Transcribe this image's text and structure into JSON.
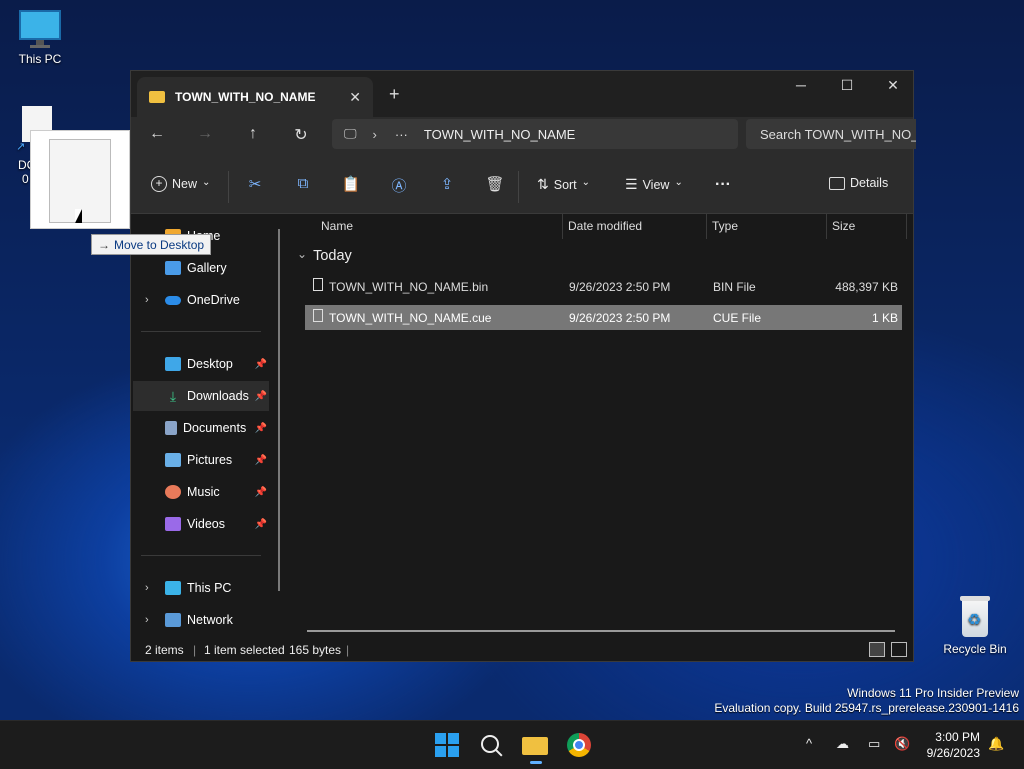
{
  "desktop": {
    "this_pc_label": "This PC",
    "dragged_icon_label_line1": "DC",
    "dragged_icon_label_line2": "0",
    "recycle_bin_label": "Recycle Bin",
    "drag_tooltip": "Move to Desktop",
    "drag_tooltip_arrow": "→",
    "watermark_line1": "Windows 11 Pro Insider Preview",
    "watermark_line2": "Evaluation copy. Build 25947.rs_prerelease.230901-1416"
  },
  "window": {
    "tab_title": "TOWN_WITH_NO_NAME",
    "tab_close": "✕",
    "new_tab": "+",
    "minimize": "─",
    "maximize": "☐",
    "close": "✕",
    "address": {
      "computer_glyph": "🖵",
      "sep": "›",
      "ellipsis": "···",
      "current": "TOWN_WITH_NO_NAME"
    },
    "search_placeholder": "Search TOWN_WITH_NO_NAME"
  },
  "nav_buttons": {
    "back": "←",
    "forward": "→",
    "up": "↑",
    "refresh": "↻"
  },
  "toolbar": {
    "new_label": "New",
    "sort_label": "Sort",
    "view_label": "View",
    "more": "···",
    "details_label": "Details",
    "dropdown": "⌄"
  },
  "sidebar": {
    "items": [
      {
        "label": "Home"
      },
      {
        "label": "Gallery"
      },
      {
        "label": "OneDrive"
      },
      {
        "label": "Desktop"
      },
      {
        "label": "Downloads"
      },
      {
        "label": "Documents"
      },
      {
        "label": "Pictures"
      },
      {
        "label": "Music"
      },
      {
        "label": "Videos"
      },
      {
        "label": "This PC"
      },
      {
        "label": "Network"
      }
    ],
    "pin": "📌",
    "chevron": "›"
  },
  "columns": {
    "name": "Name",
    "date": "Date modified",
    "type": "Type",
    "size": "Size"
  },
  "group": {
    "label": "Today",
    "chevron": "⌄"
  },
  "files": [
    {
      "name": "TOWN_WITH_NO_NAME.bin",
      "date": "9/26/2023 2:50 PM",
      "type": "BIN File",
      "size": "488,397 KB"
    },
    {
      "name": "TOWN_WITH_NO_NAME.cue",
      "date": "9/26/2023 2:50 PM",
      "type": "CUE File",
      "size": "1 KB"
    }
  ],
  "status": {
    "item_count": "2 items",
    "selection": "1 item selected",
    "selection_size": "165 bytes"
  },
  "taskbar": {
    "time": "3:00 PM",
    "date": "9/26/2023",
    "tray_chevron": "^"
  },
  "colors": {
    "accent": "#0078d4",
    "folder": "#f0c040",
    "selected_row": "#777777"
  }
}
